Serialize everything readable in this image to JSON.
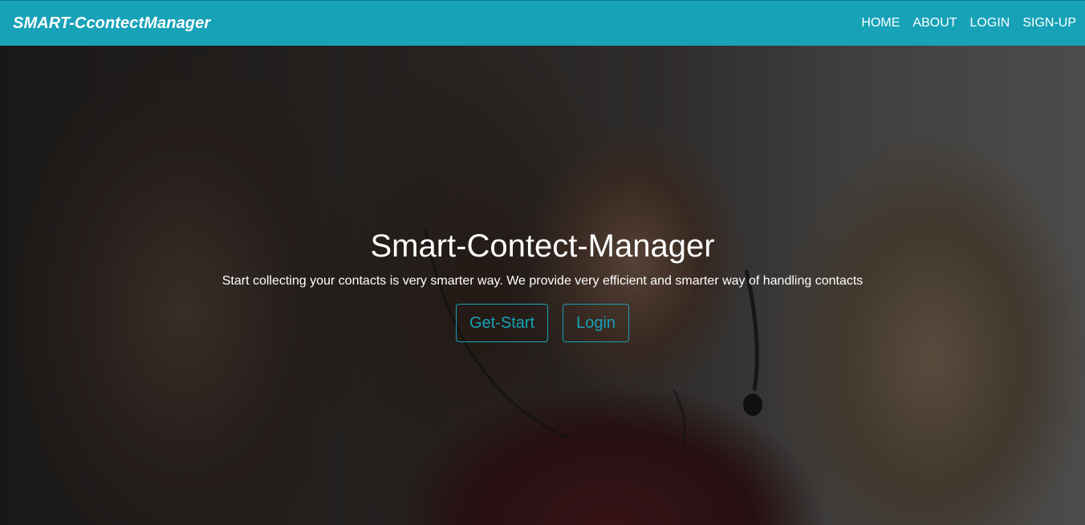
{
  "navbar": {
    "brand": "SMART-CcontectManager",
    "links": [
      "HOME",
      "ABOUT",
      "LOGIN",
      "SIGN-UP"
    ]
  },
  "hero": {
    "title": "Smart-Contect-Manager",
    "subtitle": "Start collecting your contacts is very smarter way. We provide very efficient and smarter way of handling contacts",
    "buttons": {
      "get_start": "Get-Start",
      "login": "Login"
    }
  },
  "colors": {
    "navbar_bg": "#17a2b8",
    "button_outline": "#17a2b8"
  }
}
